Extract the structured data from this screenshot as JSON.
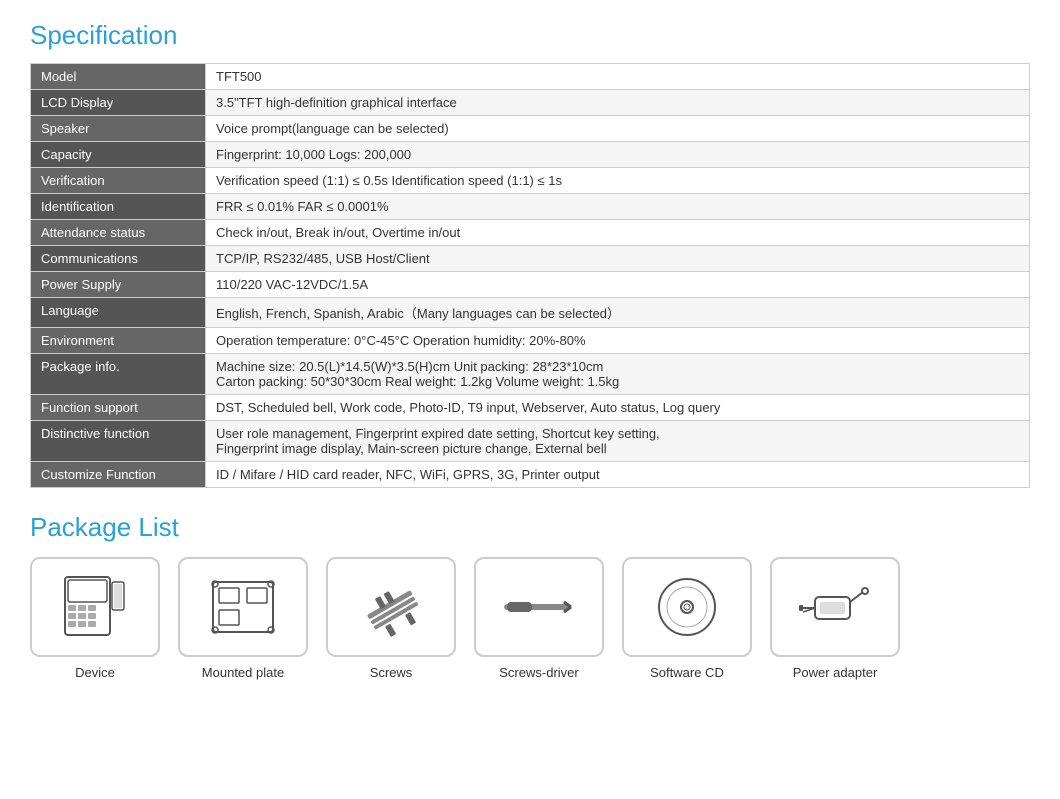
{
  "spec_title": "Specification",
  "package_title": "Package List",
  "rows": [
    {
      "label": "Model",
      "value": "TFT500"
    },
    {
      "label": "LCD Display",
      "value": "3.5\"TFT high-definition graphical interface"
    },
    {
      "label": "Speaker",
      "value": "Voice prompt(language can be selected)"
    },
    {
      "label": "Capacity",
      "value": "Fingerprint: 10,000      Logs: 200,000"
    },
    {
      "label": "Verification",
      "value": "Verification speed (1:1) ≤ 0.5s       Identification speed (1:1) ≤ 1s"
    },
    {
      "label": "Identification",
      "value": "FRR ≤ 0.01%   FAR ≤ 0.0001%"
    },
    {
      "label": "Attendance status",
      "value": "Check in/out, Break in/out, Overtime in/out"
    },
    {
      "label": "Communications",
      "value": "TCP/IP, RS232/485, USB Host/Client"
    },
    {
      "label": "Power Supply",
      "value": "110/220 VAC-12VDC/1.5A"
    },
    {
      "label": "Language",
      "value": "English, French, Spanish, Arabic（Many languages can be selected）"
    },
    {
      "label": "Environment",
      "value": "Operation temperature: 0°C-45°C       Operation humidity: 20%-80%"
    },
    {
      "label": "Package info.",
      "value": "Machine size: 20.5(L)*14.5(W)*3.5(H)cm      Unit packing: 28*23*10cm\nCarton packing: 50*30*30cm    Real weight: 1.2kg     Volume weight: 1.5kg"
    },
    {
      "label": "Function support",
      "value": "DST, Scheduled bell, Work code, Photo-ID, T9 input, Webserver, Auto status, Log query"
    },
    {
      "label": "Distinctive function",
      "value": "User role management, Fingerprint expired date setting, Shortcut key setting,\nFingerprint image display, Main-screen picture change, External bell"
    },
    {
      "label": "Customize Function",
      "value": "ID / Mifare / HID card reader, NFC, WiFi, GPRS, 3G, Printer output"
    }
  ],
  "package_items": [
    {
      "name": "Device",
      "icon": "device"
    },
    {
      "name": "Mounted plate",
      "icon": "plate"
    },
    {
      "name": "Screws",
      "icon": "screws"
    },
    {
      "name": "Screws-driver",
      "icon": "driver"
    },
    {
      "name": "Software CD",
      "icon": "cd"
    },
    {
      "name": "Power adapter",
      "icon": "adapter"
    }
  ]
}
